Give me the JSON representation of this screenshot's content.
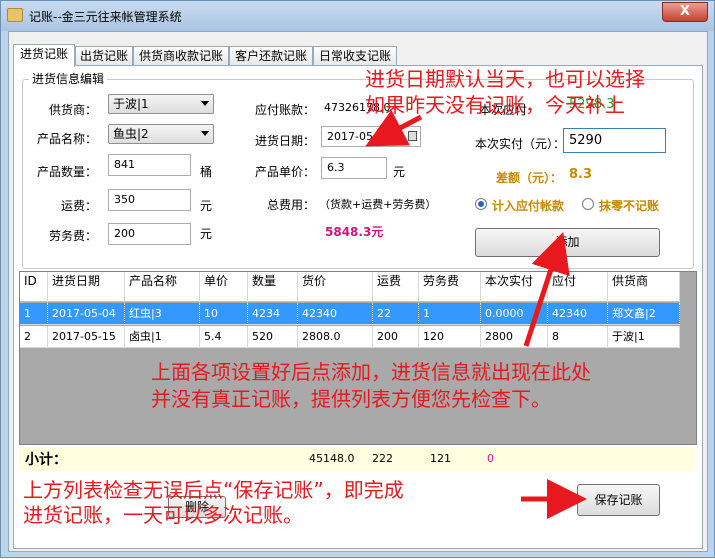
{
  "window": {
    "title": "记账--金三元往来帐管理系统",
    "close_label": "X"
  },
  "tabs": [
    {
      "label": "进货记账",
      "active": true
    },
    {
      "label": "出货记账",
      "active": false
    },
    {
      "label": "供货商收款记账",
      "active": false
    },
    {
      "label": "客户还款记账",
      "active": false
    },
    {
      "label": "日常收支记账",
      "active": false
    }
  ],
  "form": {
    "group_title": "进货信息编辑",
    "supplier": {
      "label": "供货商：",
      "value": "于波|1"
    },
    "product_name": {
      "label": "产品名称：",
      "value": "鱼虫|2"
    },
    "quantity": {
      "label": "产品数量：",
      "value": "841",
      "unit": "桶"
    },
    "freight": {
      "label": "运费：",
      "value": "350",
      "unit": "元"
    },
    "labor": {
      "label": "劳务费：",
      "value": "200",
      "unit": "元"
    },
    "payable": {
      "label": "应付账款：",
      "value": "47326178.0"
    },
    "purchase_date": {
      "label": "进货日期：",
      "value": "2017-05-15"
    },
    "unit_price": {
      "label": "产品单价：",
      "value": "6.3",
      "unit": "元"
    },
    "total_cost": {
      "label": "总费用：",
      "formula": "（货款+运费+劳务费）",
      "value": "5848.3元"
    },
    "due_this_time": {
      "label": "本次应付",
      "value": "5298.3"
    },
    "paid_this_time": {
      "label": "本次实付（元）：",
      "value": "5290"
    },
    "difference": {
      "label": "差额（元）：",
      "value": "8.3"
    },
    "radio_payable": {
      "label": "计入应付帐款",
      "checked": true
    },
    "radio_ignore": {
      "label": "抹零不记账",
      "checked": false
    },
    "add_button": "添加"
  },
  "table": {
    "columns": [
      "ID",
      "进货日期",
      "产品名称",
      "单价",
      "数量",
      "货价",
      "运费",
      "劳务费",
      "本次实付",
      "应付",
      "供货商"
    ],
    "rows": [
      {
        "id": "1",
        "date": "2017-05-04",
        "product": "红虫|3",
        "price": "10",
        "qty": "4234",
        "goods": "42340",
        "freight": "22",
        "labor": "1",
        "paid": "0.0000",
        "due": "42340",
        "supplier": "郑文鑫|2",
        "selected": true
      },
      {
        "id": "2",
        "date": "2017-05-15",
        "product": "卤虫|1",
        "price": "5.4",
        "qty": "520",
        "goods": "2808.0",
        "freight": "200",
        "labor": "120",
        "paid": "2800",
        "due": "8",
        "supplier": "于波|1",
        "selected": false
      }
    ]
  },
  "subtotal": {
    "label": "小计：",
    "goods": "45148.0",
    "freight": "222",
    "labor": "121",
    "extra": "0"
  },
  "bottom": {
    "delete_label": "删除",
    "save_label": "保存记账"
  },
  "annotations": {
    "date_note_line1": "进货日期默认当天，也可以选择",
    "date_note_line2": "如果昨天没有记账，今天补上",
    "add_note_line1": "上面各项设置好后点添加，进货信息就出现在此处",
    "add_note_line2": "并没有真正记账，提供列表方便您先检查下。",
    "save_note_line1": "上方列表检查无误后点“保存记账”，即完成",
    "save_note_line2": "进货记账，一天可以多次记账。"
  },
  "colors": {
    "annotation": "#e8191e",
    "selected_row": "#3399ff",
    "green_value": "#2e9e2e",
    "orange_text": "#c98a00",
    "pink_total": "#d4147a"
  }
}
